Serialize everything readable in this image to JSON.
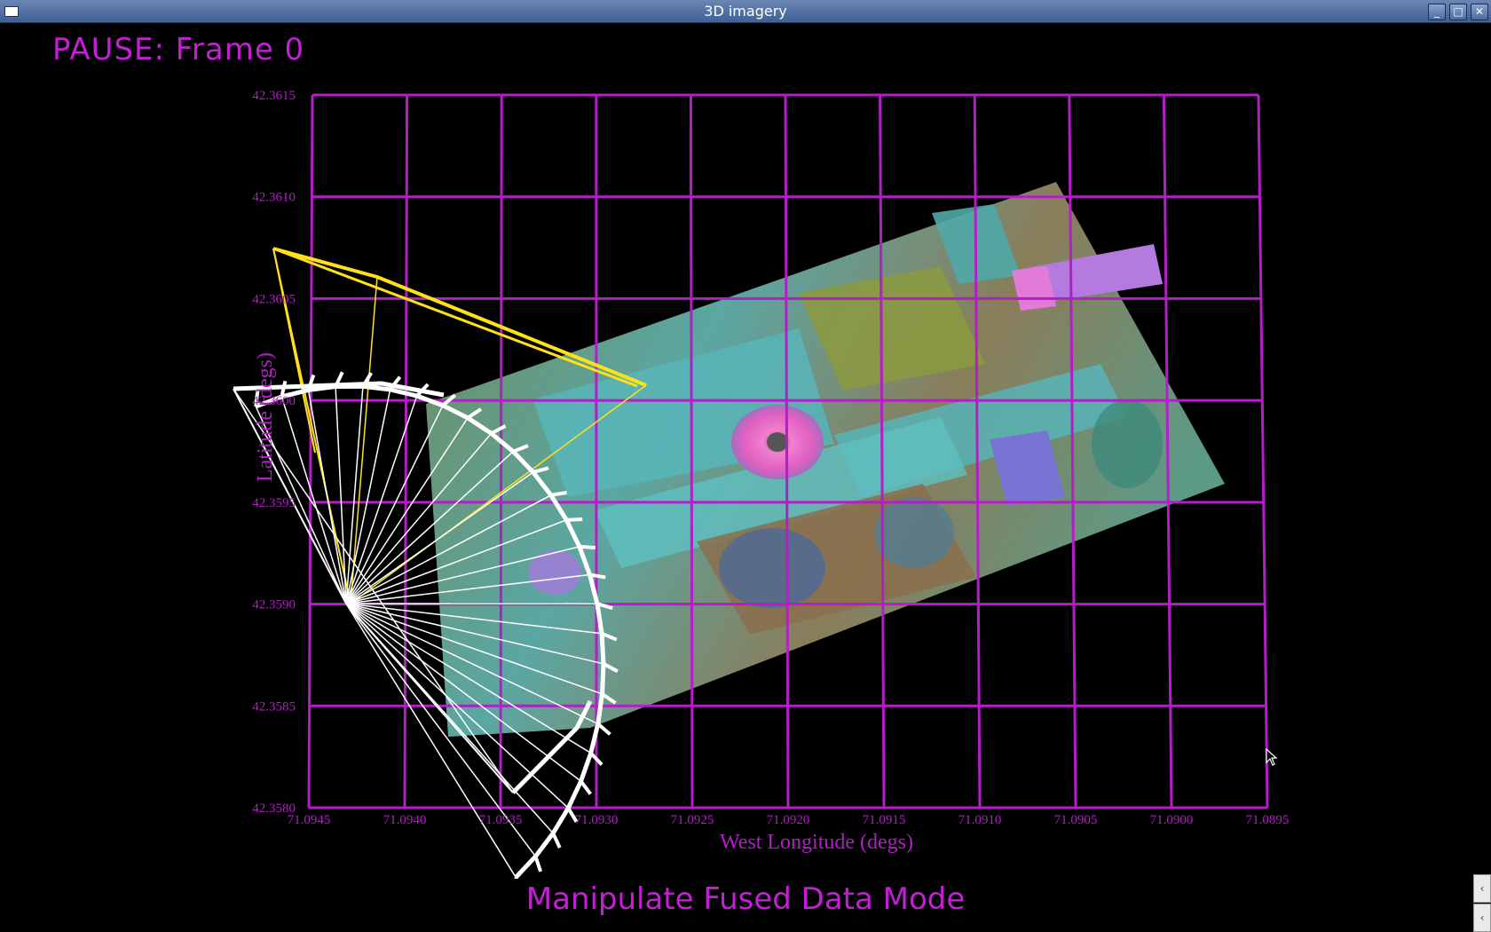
{
  "window": {
    "title": "3D imagery"
  },
  "status": {
    "text": "PAUSE: Frame 0"
  },
  "mode": {
    "text": "Manipulate Fused Data Mode"
  },
  "colors": {
    "accent": "#c41fd6",
    "grid": "#b31ec7",
    "frustum_white": "#ffffff",
    "frustum_yellow": "#ffe11a"
  },
  "icons": [
    "window-menu-icon",
    "minimize-icon",
    "maximize-icon",
    "close-icon",
    "scroll-left-icon",
    "mouse-pointer-icon"
  ],
  "chart_data": {
    "type": "map",
    "xlabel": "West Longitude (degs)",
    "ylabel": "Latitude (degs)",
    "x_ticks": [
      "71.0945",
      "71.0940",
      "71.0935",
      "71.0930",
      "71.0925",
      "71.0920",
      "71.0915",
      "71.0910",
      "71.0905",
      "71.0900",
      "71.0895"
    ],
    "y_ticks": [
      "42.3615",
      "42.3610",
      "42.3605",
      "42.3600",
      "42.3595",
      "42.3590",
      "42.3585",
      "42.3580"
    ],
    "xlim": [
      71.0945,
      71.0895
    ],
    "ylim": [
      42.358,
      42.3615
    ],
    "grid": true
  }
}
